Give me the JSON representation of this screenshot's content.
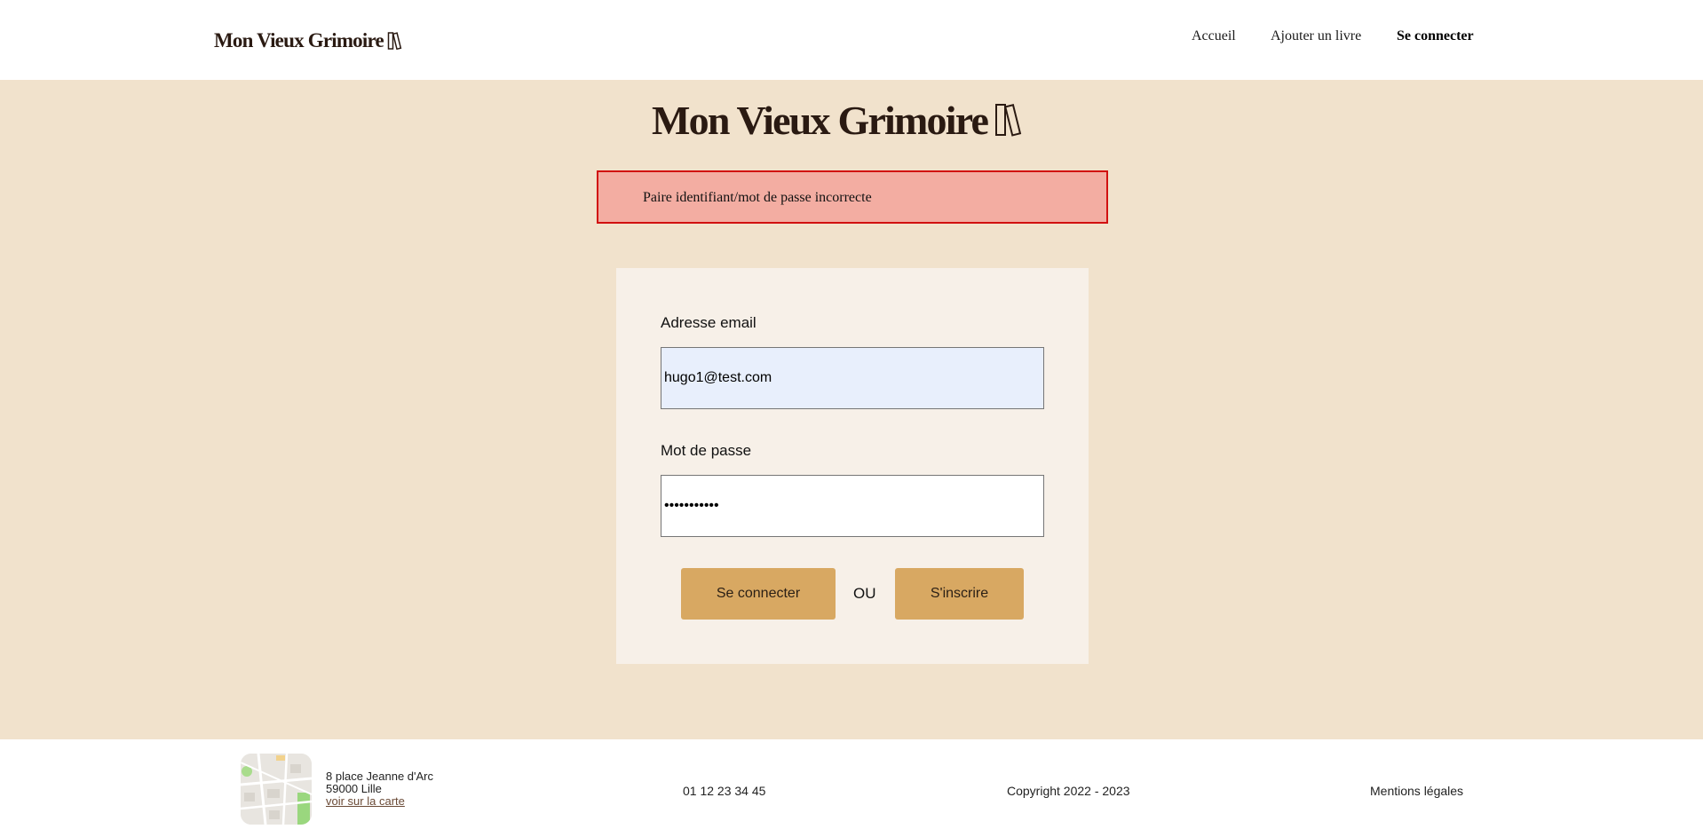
{
  "header": {
    "logo_text": "Mon Vieux Grimoire",
    "nav": {
      "home": "Accueil",
      "add_book": "Ajouter un livre",
      "login": "Se connecter"
    }
  },
  "main": {
    "title": "Mon Vieux Grimoire",
    "error_message": "Paire identifiant/mot de passe incorrecte",
    "form": {
      "email_label": "Adresse email",
      "email_value": "hugo1@test.com",
      "password_label": "Mot de passe",
      "password_value": "•••••••••••",
      "login_button": "Se connecter",
      "or_text": "OU",
      "register_button": "S'inscrire"
    }
  },
  "footer": {
    "address_line1": "8 place Jeanne d'Arc",
    "address_line2": "59000 Lille",
    "map_link": "voir sur la carte",
    "phone": "01 12 23 34 45",
    "copyright": "Copyright 2022 - 2023",
    "legal": "Mentions légales"
  },
  "icons": {
    "logo_icon": "books-icon",
    "map_thumbnail": "map-thumbnail"
  },
  "colors": {
    "page_background": "#f1e2cc",
    "card_background": "#f7f0e8",
    "error_background": "#f3ada2",
    "error_border": "#d11010",
    "button": "#d8a862",
    "email_autofill": "#e8effc"
  }
}
